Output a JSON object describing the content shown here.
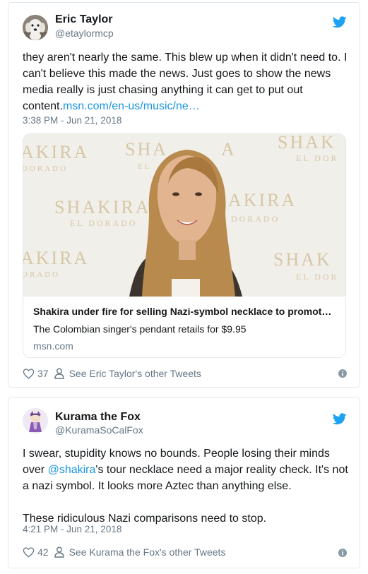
{
  "colors": {
    "link": "#1b95e0",
    "secondary": "#657786",
    "border": "#e1e8ed",
    "twitter_blue": "#1da1f2"
  },
  "tweets": [
    {
      "avatar_icon": "dog-avatar",
      "name": "Eric Taylor",
      "handle": "@etaylormcp",
      "text": "they aren't nearly the same. This blew up when it didn't need to. I can't believe this made the news. Just goes to show the news media really is just chasing anything it can get to put out content.",
      "link": "msn.com/en-us/music/ne…",
      "timestamp": "3:38 PM - Jun 21, 2018",
      "card": {
        "image_texts": [
          "AKIRA",
          "DORADO",
          "SHA",
          "EL",
          "A",
          "SHAK",
          "EL DOR",
          "SHAKIRA",
          "EL DORADO",
          "AKIRA",
          "DORADO",
          "AKIRA",
          "ORADO",
          "SHAK",
          "EL DOR"
        ],
        "title": "Shakira under fire for selling Nazi-symbol necklace to promot…",
        "description": "The Colombian singer's pendant retails for $9.95",
        "domain": "msn.com"
      },
      "likes": "37",
      "other_tweets": "See Eric Taylor's other Tweets"
    },
    {
      "avatar_icon": "fox-avatar",
      "name": "Kurama the Fox",
      "handle": "@KuramaSoCalFox",
      "text_before_mention": "I swear, stupidity knows no bounds. People losing their minds over ",
      "mention": "@shakira",
      "text_after_mention": "'s tour necklace need a major reality check. It's not a nazi symbol. It looks more Aztec than anything else.",
      "text_para2": "These ridiculous Nazi comparisons need to stop.",
      "timestamp": "4:21 PM - Jun 21, 2018",
      "likes": "42",
      "other_tweets": "See Kurama the Fox's other Tweets"
    }
  ]
}
